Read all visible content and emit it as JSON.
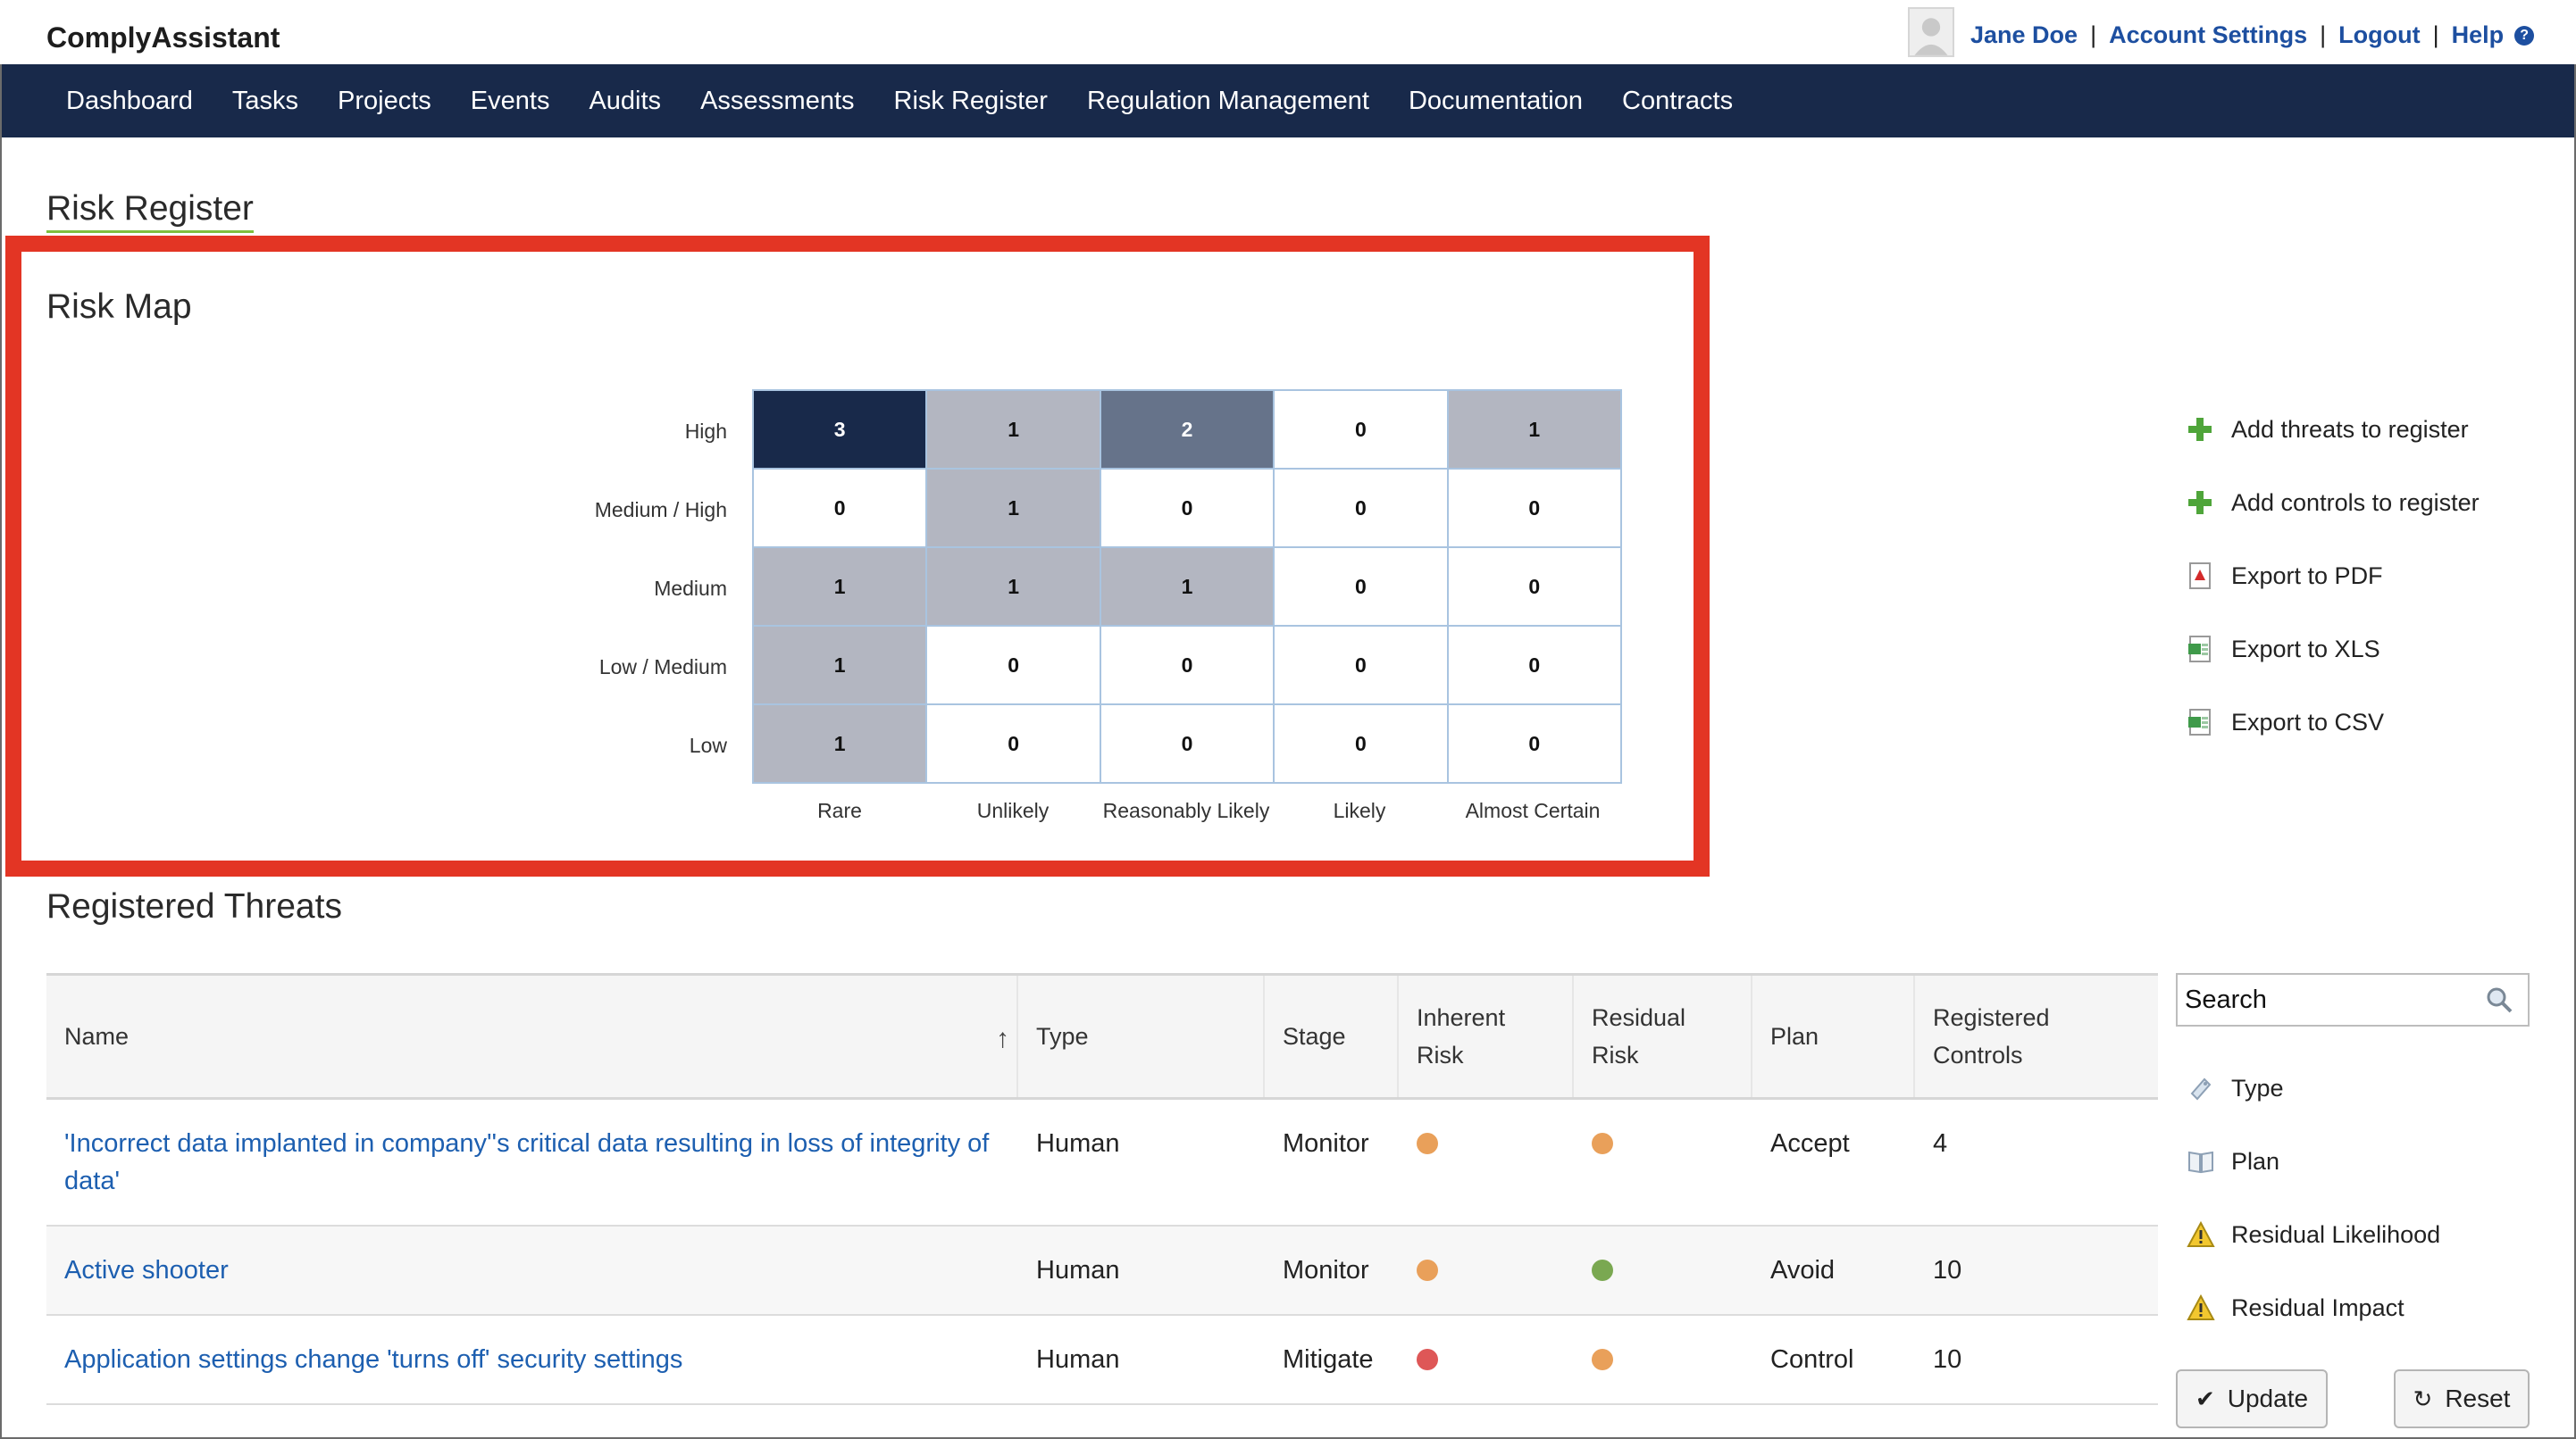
{
  "app": {
    "name": "ComplyAssistant"
  },
  "user": {
    "name": "Jane Doe",
    "links": [
      "Account Settings",
      "Logout",
      "Help"
    ]
  },
  "nav": [
    "Dashboard",
    "Tasks",
    "Projects",
    "Events",
    "Audits",
    "Assessments",
    "Risk Register",
    "Regulation Management",
    "Documentation",
    "Contracts"
  ],
  "page": {
    "title": "Risk Register"
  },
  "risk_map": {
    "title": "Risk Map",
    "rows": [
      "High",
      "Medium / High",
      "Medium",
      "Low / Medium",
      "Low"
    ],
    "cols": [
      "Rare",
      "Unlikely",
      "Reasonably Likely",
      "Likely",
      "Almost Certain"
    ],
    "values": [
      [
        3,
        1,
        2,
        0,
        1
      ],
      [
        0,
        1,
        0,
        0,
        0
      ],
      [
        1,
        1,
        1,
        0,
        0
      ],
      [
        1,
        0,
        0,
        0,
        0
      ],
      [
        1,
        0,
        0,
        0,
        0
      ]
    ],
    "colors": {
      "dark": "#18294a",
      "mid": "#66738a",
      "light": "#b3b6c1",
      "empty": "#ffffff",
      "border": "#a9c4e0"
    }
  },
  "actions": [
    {
      "label": "Add threats to register",
      "icon": "plus-icon"
    },
    {
      "label": "Add controls to register",
      "icon": "plus-icon"
    },
    {
      "label": "Export to PDF",
      "icon": "pdf-icon"
    },
    {
      "label": "Export to XLS",
      "icon": "xls-icon"
    },
    {
      "label": "Export to CSV",
      "icon": "csv-icon"
    }
  ],
  "threats": {
    "title": "Registered Threats",
    "columns": [
      "Name",
      "Type",
      "Stage",
      "Inherent Risk",
      "Residual Risk",
      "Plan",
      "Registered Controls"
    ],
    "rows": [
      {
        "name": "'Incorrect data implanted in company''s critical data resulting in loss of integrity of data'",
        "type": "Human",
        "stage": "Monitor",
        "inherent": "#e9a05a",
        "residual": "#e9a05a",
        "plan": "Accept",
        "controls": "4"
      },
      {
        "name": "Active shooter",
        "type": "Human",
        "stage": "Monitor",
        "inherent": "#e9a05a",
        "residual": "#7aa851",
        "plan": "Avoid",
        "controls": "10"
      },
      {
        "name": "Application settings change 'turns off' security settings",
        "type": "Human",
        "stage": "Mitigate",
        "inherent": "#de5757",
        "residual": "#e9a05a",
        "plan": "Control",
        "controls": "10"
      }
    ]
  },
  "filters": {
    "search_placeholder": "Search",
    "items": [
      {
        "label": "Type",
        "icon": "tag-icon"
      },
      {
        "label": "Plan",
        "icon": "book-icon"
      },
      {
        "label": "Residual Likelihood",
        "icon": "warning-icon"
      },
      {
        "label": "Residual Impact",
        "icon": "warning-icon"
      }
    ],
    "update_label": "Update",
    "reset_label": "Reset"
  }
}
